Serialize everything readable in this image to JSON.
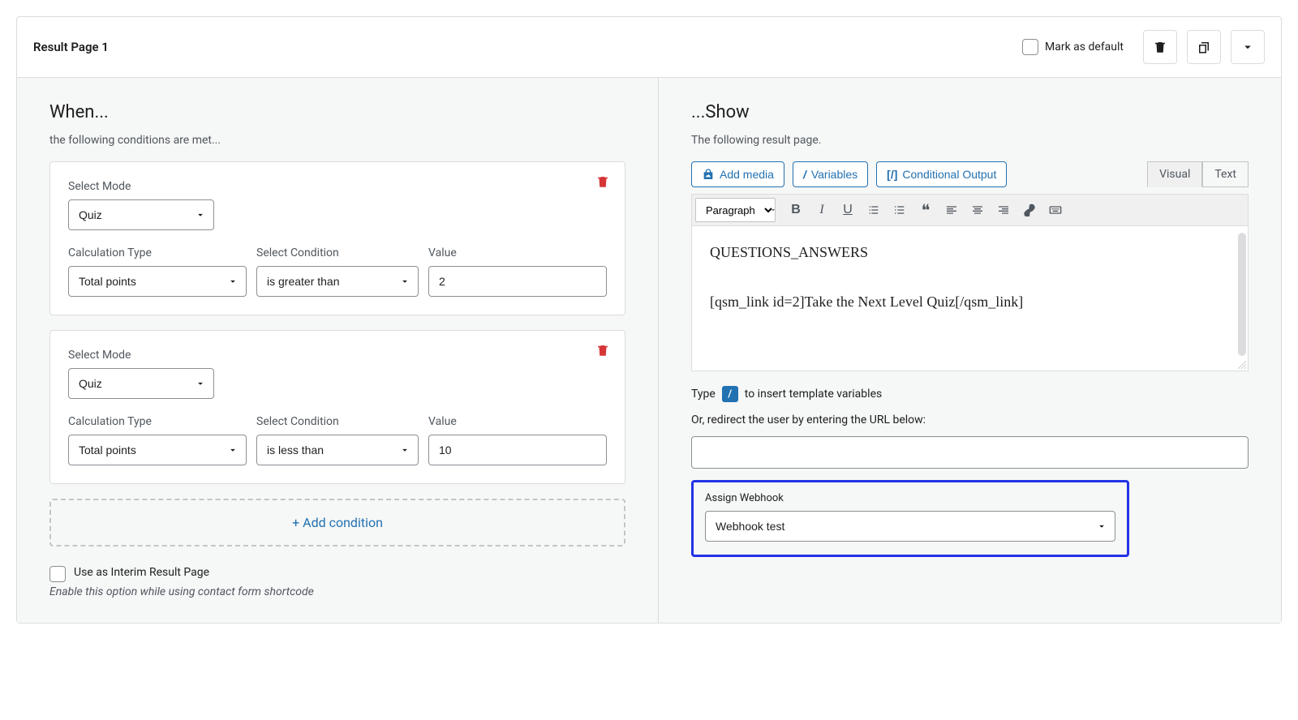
{
  "header": {
    "title": "Result Page 1",
    "mark_default_label": "Mark as default"
  },
  "when": {
    "title": "When...",
    "sub": "the following conditions are met...",
    "mode_label": "Select Mode",
    "calc_label": "Calculation Type",
    "cond_label": "Select Condition",
    "value_label": "Value",
    "conditions": [
      {
        "mode": "Quiz",
        "calc": "Total points",
        "cond": "is greater than",
        "value": "2"
      },
      {
        "mode": "Quiz",
        "calc": "Total points",
        "cond": "is less than",
        "value": "10"
      }
    ],
    "add_condition": "+ Add condition",
    "interim_label": "Use as Interim Result Page",
    "interim_help": "Enable this option while using contact form shortcode"
  },
  "show": {
    "title": "...Show",
    "sub": "The following result page.",
    "add_media": "Add media",
    "variables": "Variables",
    "conditional_output": "Conditional Output",
    "tab_visual": "Visual",
    "tab_text": "Text",
    "format_select": "Paragraph",
    "editor_line1": "QUESTIONS_ANSWERS",
    "editor_line2": "[qsm_link id=2]Take the Next Level Quiz[/qsm_link]",
    "hint_prefix": "Type",
    "hint_slash": "/",
    "hint_suffix": "to insert template variables",
    "redirect_label": "Or, redirect the user by entering the URL below:",
    "redirect_value": "",
    "webhook_label": "Assign Webhook",
    "webhook_value": "Webhook test"
  }
}
